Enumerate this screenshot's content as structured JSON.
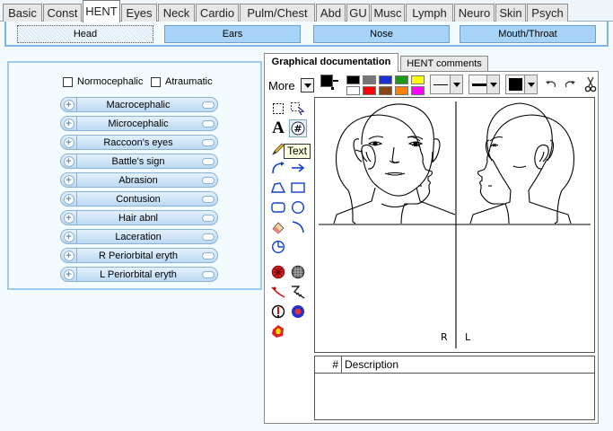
{
  "top_tabs": [
    "Basic",
    "Const",
    "HENT",
    "Eyes",
    "Neck",
    "Cardio",
    "Pulm/Chest",
    "Abd",
    "GU",
    "Musc",
    "Lymph",
    "Neuro",
    "Skin",
    "Psych"
  ],
  "active_top_tab": "HENT",
  "sub_tabs": [
    "Head",
    "Ears",
    "Nose",
    "Mouth/Throat"
  ],
  "active_sub_tab": "Head",
  "checkboxes": [
    "Normocephalic",
    "Atraumatic"
  ],
  "findings": [
    "Macrocephalic",
    "Microcephalic",
    "Raccoon's eyes",
    "Battle's sign",
    "Abrasion",
    "Contusion",
    "Hair abnl",
    "Laceration",
    "R Periorbital eryth",
    "L Periorbital eryth"
  ],
  "right_tabs": {
    "graphical": "Graphical documentation",
    "comments": "HENT comments"
  },
  "toolbar": {
    "more_label": "More"
  },
  "palette_colors": [
    "#000000",
    "#777777",
    "#1a2fd8",
    "#1a9a1a",
    "#ffff00",
    "#ffffff",
    "#ff0000",
    "#8b4513",
    "#ff8000",
    "#ff00ff"
  ],
  "tooltip": "Text",
  "canvas_labels": {
    "right": "R",
    "left": "L"
  },
  "description_table": {
    "col_num": "#",
    "col_desc": "Description"
  }
}
